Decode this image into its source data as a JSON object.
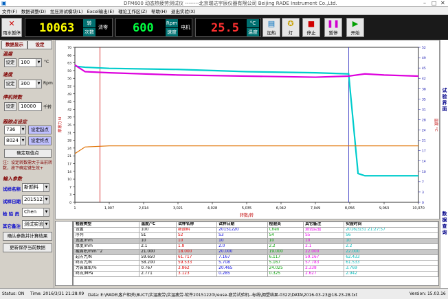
{
  "window": {
    "title": "DFM600 动态热疲劳测试仪 --------北京瑞达宇辰仪器有限公司 Beijing RADE Instrument Co.,Ltd."
  },
  "menu": [
    "文件(F)",
    "数据调整(D)",
    "拉压测试模块(L)",
    "Excel输出(E)",
    "理论工作区(Z)",
    "帮助(H)",
    "退出实验(X)"
  ],
  "toolbar": {
    "rain_label": "雨水暂停",
    "count_value": "10063",
    "count_unit1": "转",
    "count_unit2": "次数",
    "count_side": "清零",
    "speed_value": "600",
    "speed_unit1": "Rpm",
    "speed_unit2": "速度",
    "speed_side": "电机",
    "temp_value": "25.5",
    "temp_unit1": "°C",
    "temp_unit2": "温度",
    "btn_heat": "加热",
    "btn_light": "灯",
    "btn_stop": "停止",
    "btn_pause": "暂停",
    "btn_start": "开始"
  },
  "left": {
    "tabs": [
      "数据显示",
      "设定"
    ],
    "temp_title": "温度",
    "temp_btn": "设定",
    "temp_value": "100",
    "temp_unit": "°C",
    "speed_title": "速度",
    "speed_btn": "设定",
    "speed_value": "300",
    "speed_unit": "Rpm",
    "stop_title": "停机转数",
    "stop_btn": "设定",
    "stop_value": "10000",
    "stop_unit": "千转",
    "track_title": "跟踪点设定",
    "track1_value": "736",
    "track1_btn": "设定起点",
    "track2_value": "8024",
    "track2_btn": "设定终点",
    "track_confirm": "确定取值点",
    "note": "注：设定转数需大于当前转数，按下确定键生效+",
    "input_title": "输入参数",
    "f1_label": "试样名称",
    "f1_value": "新颜料",
    "f2_label": "试样日期",
    "f2_value": "20151220",
    "f3_label": "检 验 员",
    "f3_value": "Chen",
    "f4_label": "其它备注",
    "f4_value": "测试实验",
    "btn_confirm": "确认参数并计算结果",
    "btn_save": "更新保存当前数据"
  },
  "chart_data": {
    "type": "line",
    "x_ticks": [
      "1",
      "1,007",
      "2,014",
      "3,021",
      "4,028",
      "5,035",
      "6,042",
      "7,049",
      "8,056",
      "9,063",
      "10,070"
    ],
    "xlabel": "转数/转",
    "y_left_ticks": [
      "0",
      "3",
      "7",
      "10",
      "14",
      "17",
      "21",
      "24",
      "28",
      "31",
      "35",
      "38",
      "42",
      "45",
      "49",
      "52",
      "56",
      "59",
      "63",
      "66",
      "70"
    ],
    "y_right_ticks": [
      "0",
      "3",
      "7",
      "10",
      "14",
      "17",
      "21",
      "24",
      "28",
      "31",
      "35",
      "38",
      "42",
      "45",
      "49",
      "52"
    ],
    "ylabel_left": "摩擦力 N",
    "ylabel_right": "温度 °C",
    "marker_start": 736,
    "marker_end": 8024,
    "series": [
      {
        "name": "cyan",
        "color": "#00cccc",
        "x": [
          1,
          300,
          1007,
          3021,
          5035,
          7049,
          8024,
          8300,
          8500,
          10070
        ],
        "y": [
          61.5,
          61,
          60.5,
          60,
          59,
          58.5,
          58,
          13,
          12,
          12
        ]
      },
      {
        "name": "magenta",
        "color": "#dd00dd",
        "x": [
          1,
          300,
          1007,
          3021,
          5035,
          7049,
          8024,
          8500,
          9063,
          10070
        ],
        "y": [
          62,
          59,
          58.5,
          57.5,
          57,
          56.5,
          57,
          58,
          57.5,
          57
        ]
      },
      {
        "name": "orange",
        "color": "#e07000",
        "x": [
          1,
          300,
          1007,
          5035,
          10070
        ],
        "y": [
          22,
          25,
          25.5,
          25.5,
          25.5
        ]
      }
    ]
  },
  "right_strip": {
    "top": "试验界面",
    "bottom": "数据查询"
  },
  "table": {
    "side_labels": [
      "",
      "",
      "",
      "",
      "",
      "",
      "",
      "",
      "",
      "",
      ""
    ],
    "header": [
      "检验类型",
      "温度/°C",
      "试样名称",
      "试样日期",
      "检验员",
      "其它备注",
      "实验时间"
    ],
    "rows": [
      [
        "设置",
        "100",
        "新颜料",
        "20151220",
        "Chen",
        "测试实验",
        "2016/3/31 21:27:57"
      ],
      [
        "序列",
        "S1",
        "S2",
        "S3",
        "S4",
        "S5",
        "S6"
      ],
      [
        "宽度/mm",
        "10",
        "10",
        "10",
        "10",
        "10",
        "10"
      ],
      [
        "厚度/mm",
        "2.1",
        "1.8",
        "2.0",
        "2.2",
        "2.1",
        "2.2"
      ],
      [
        "截面积/mm^2",
        "21.000",
        "18.000",
        "20.000",
        "19.000",
        "22.000",
        "22.000"
      ],
      [
        "起点力/N",
        "59.650",
        "61.717",
        "7.167",
        "6.117",
        "59.167",
        "62.433"
      ],
      [
        "终点力/N",
        "58.200",
        "59.533",
        "5.708",
        "5.167",
        "57.783",
        "61.533"
      ],
      [
        "力衰减率/%",
        "0.767",
        "3.862",
        "20.465",
        "24.025",
        "2.338",
        "3.769"
      ],
      [
        "终点/MPa",
        "2.771",
        "3.123",
        "0.285",
        "0.325",
        "2.627",
        "2.942"
      ]
    ],
    "row_colors": [
      "#ffffff",
      "#ffffff",
      "#c8c8c8",
      "#ffffff",
      "#c8c8c8",
      "#ffffff",
      "#ffffff",
      "#ffffff",
      "#ffffff"
    ],
    "col_colors": [
      "#000000",
      "#000000",
      "#e00000",
      "#0000e0",
      "#00a000",
      "#ee00ee",
      "#00bbbb"
    ]
  },
  "status": {
    "status": "Status: ON",
    "time": "Time: 2016/3/31 21:28:09",
    "data": "Data: E:\\RADE\\客户相关\\BUCT\\实温疲劳\\实温疲劳-软件20151220\\reuse-疲劳试验机--标线\\拥塑结果-0322\\DATA\\2016-03-23@18-23-28.txt",
    "version": "Version: 15.03.16"
  }
}
